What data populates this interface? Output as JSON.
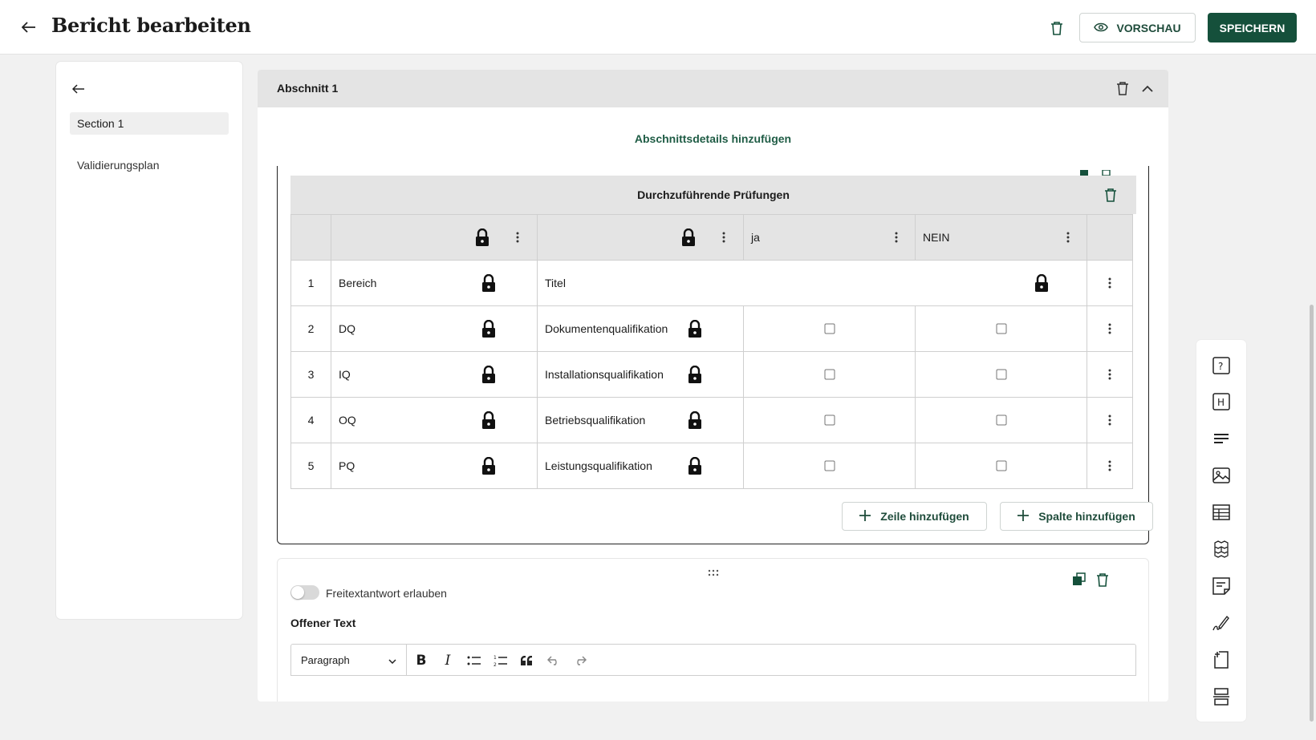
{
  "header": {
    "title": "Bericht bearbeiten",
    "preview_label": "VORSCHAU",
    "save_label": "SPEICHERN"
  },
  "sidebar": {
    "items": [
      {
        "label": "Section 1",
        "active": true
      },
      {
        "label": "Validierungsplan",
        "active": false
      }
    ]
  },
  "section": {
    "title": "Abschnitt 1",
    "add_details_label": "Abschnittsdetails hinzufügen"
  },
  "table": {
    "title": "Durchzuführende Prüfungen",
    "header": [
      "",
      "",
      "ja",
      "NEIN"
    ],
    "rows": [
      {
        "num": "1",
        "col1": "Bereich",
        "col2": "Titel",
        "merged": true
      },
      {
        "num": "2",
        "col1": "DQ",
        "col2": "Dokumentenqualifikation",
        "merged": false
      },
      {
        "num": "3",
        "col1": "IQ",
        "col2": "Installationsqualifikation",
        "merged": false
      },
      {
        "num": "4",
        "col1": "OQ",
        "col2": "Betriebsqualifikation",
        "merged": false
      },
      {
        "num": "5",
        "col1": "PQ",
        "col2": "Leistungsqualifikation",
        "merged": false
      }
    ],
    "add_row_label": "Zeile hinzufügen",
    "add_column_label": "Spalte hinzufügen"
  },
  "text_block": {
    "toggle_label": "Freitextantwort erlauben",
    "toggle_on": false,
    "field_label": "Offener Text",
    "paragraph_select": "Paragraph"
  },
  "colors": {
    "brand": "#15503b",
    "accent_text": "#1f5c45",
    "header_gray": "#e4e4e4"
  },
  "rail_icons": [
    "help-icon",
    "heading-icon",
    "text-icon",
    "image-icon",
    "table-icon",
    "blocks-icon",
    "note-icon",
    "signature-icon",
    "page-icon",
    "divider-icon"
  ]
}
